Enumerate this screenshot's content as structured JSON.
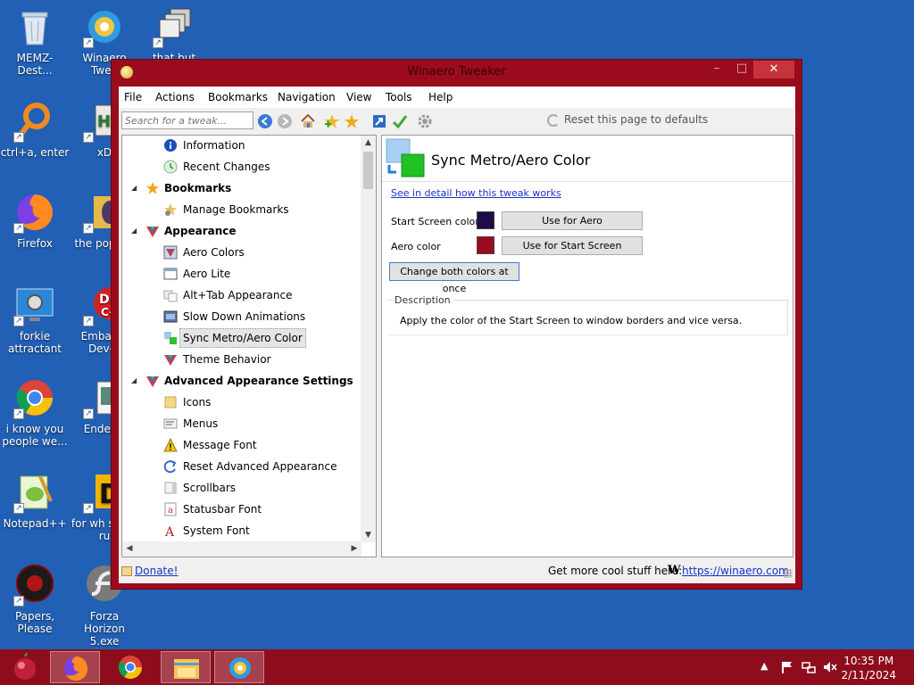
{
  "desktop": {
    "icons": [
      {
        "label": "MEMZ-Dest..."
      },
      {
        "label": "Winaero Twea"
      },
      {
        "label": "that but when"
      },
      {
        "label": "ctrl+a, enter"
      },
      {
        "label": "xD"
      },
      {
        "label": "Firefox"
      },
      {
        "label": "the pop shi"
      },
      {
        "label": "forkie attractant"
      },
      {
        "label": "Embarca Dev-C"
      },
      {
        "label": "i know you people we..."
      },
      {
        "label": "Enderm"
      },
      {
        "label": "Notepad++"
      },
      {
        "label": "for wh some ru"
      },
      {
        "label": "Papers, Please"
      },
      {
        "label": "Forza Horizon 5.exe"
      }
    ]
  },
  "window": {
    "title": "Winaero Tweaker",
    "minimize": "–",
    "maximize": "□",
    "close": "✕",
    "menu": [
      "File",
      "Actions",
      "Bookmarks",
      "Navigation",
      "View",
      "Tools",
      "Help"
    ],
    "search_placeholder": "Search for a tweak...",
    "reset_label": "Reset this page to defaults",
    "tree": [
      {
        "label": "Information"
      },
      {
        "label": "Recent Changes"
      },
      {
        "label": "Bookmarks"
      },
      {
        "label": "Manage Bookmarks"
      },
      {
        "label": "Appearance"
      },
      {
        "label": "Aero Colors"
      },
      {
        "label": "Aero Lite"
      },
      {
        "label": "Alt+Tab Appearance"
      },
      {
        "label": "Slow Down Animations"
      },
      {
        "label": "Sync Metro/Aero Color"
      },
      {
        "label": "Theme Behavior"
      },
      {
        "label": "Advanced Appearance Settings"
      },
      {
        "label": "Icons"
      },
      {
        "label": "Menus"
      },
      {
        "label": "Message Font"
      },
      {
        "label": "Reset Advanced Appearance"
      },
      {
        "label": "Scrollbars"
      },
      {
        "label": "Statusbar Font"
      },
      {
        "label": "System Font"
      }
    ],
    "content": {
      "title": "Sync Metro/Aero Color",
      "detail_link": "See in detail how this tweak works",
      "start_screen_label": "Start Screen color",
      "start_screen_color": "#1f0a4a",
      "use_for_aero": "Use for Aero",
      "aero_label": "Aero color",
      "aero_color": "#9a0c1d",
      "use_for_start": "Use for Start Screen",
      "change_both": "Change both colors at once",
      "description_label": "Description",
      "description_text": "Apply the color of the Start Screen to window borders and vice versa."
    },
    "status": {
      "donate": "Donate!",
      "more_text": "Get more cool stuff here:",
      "w": "W",
      "site": "https://winaero.com"
    }
  },
  "taskbar": {
    "time": "10:35 PM",
    "date": "2/11/2024",
    "tray_arrow": "▲"
  },
  "colors": {
    "desktop": "#2160b5",
    "window_border": "#9a0c1d",
    "taskbar": "#8e0d1c"
  }
}
